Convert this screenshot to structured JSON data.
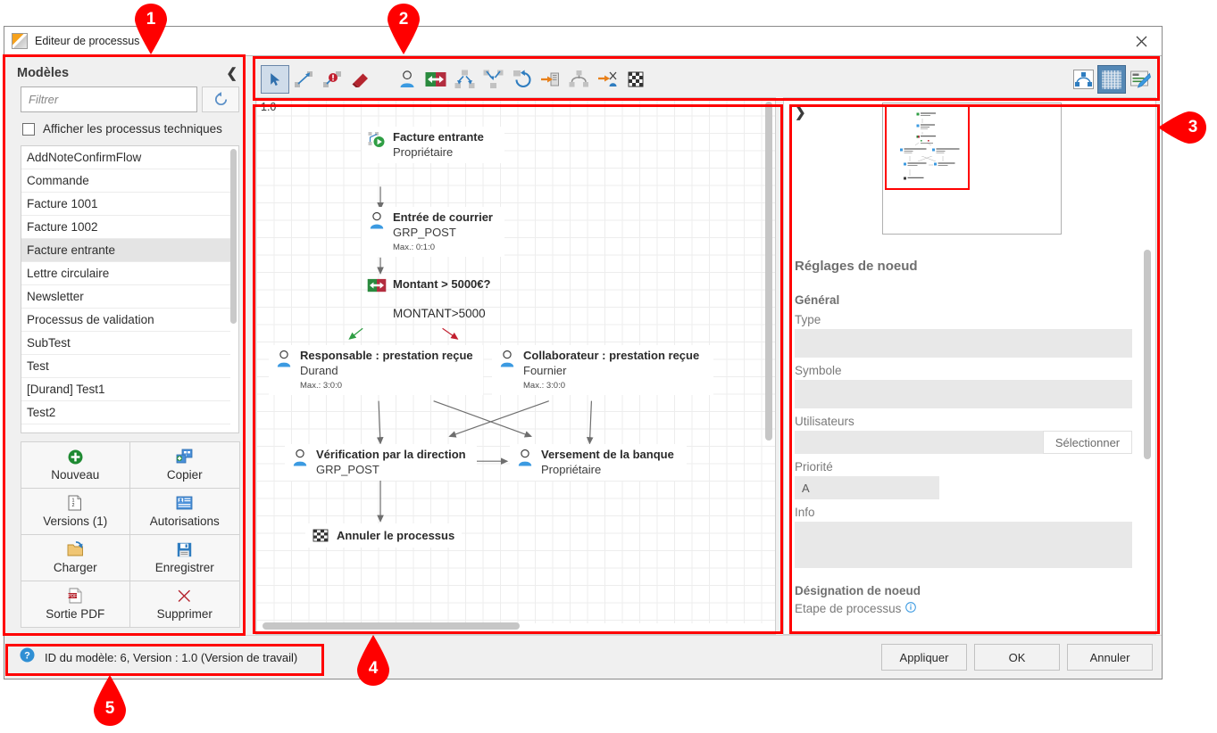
{
  "window": {
    "title": "Editeur de processus",
    "app_icon": "process-editor-icon",
    "close_icon": "close-icon"
  },
  "sidebar": {
    "title": "Modèles",
    "collapse_icon": "chevron-left-icon",
    "filter": {
      "placeholder": "Filtrer",
      "value": ""
    },
    "refresh_icon": "refresh-icon",
    "checkbox": {
      "label": "Afficher les processus techniques",
      "checked": false
    },
    "models": [
      {
        "label": "AddNoteConfirmFlow",
        "selected": false
      },
      {
        "label": "Commande",
        "selected": false
      },
      {
        "label": "Facture 1001",
        "selected": false
      },
      {
        "label": "Facture 1002",
        "selected": false
      },
      {
        "label": "Facture entrante",
        "selected": true
      },
      {
        "label": "Lettre circulaire",
        "selected": false
      },
      {
        "label": "Newsletter",
        "selected": false
      },
      {
        "label": "Processus de validation",
        "selected": false
      },
      {
        "label": "SubTest",
        "selected": false
      },
      {
        "label": "Test",
        "selected": false
      },
      {
        "label": "[Durand] Test1",
        "selected": false
      },
      {
        "label": "Test2",
        "selected": false
      }
    ],
    "buttons": [
      {
        "label": "Nouveau",
        "icon": "plus-circle-icon"
      },
      {
        "label": "Copier",
        "icon": "copy-icon"
      },
      {
        "label": "Versions (1)",
        "icon": "versions-icon"
      },
      {
        "label": "Autorisations",
        "icon": "permissions-icon"
      },
      {
        "label": "Charger",
        "icon": "load-folder-icon"
      },
      {
        "label": "Enregistrer",
        "icon": "save-floppy-icon"
      },
      {
        "label": "Sortie PDF",
        "icon": "pdf-icon"
      },
      {
        "label": "Supprimer",
        "icon": "delete-x-icon"
      }
    ]
  },
  "toolbar": {
    "left_tools": [
      {
        "name": "select-cursor-tool",
        "active": true
      },
      {
        "name": "connection-tool",
        "active": false
      },
      {
        "name": "error-connection-tool",
        "active": false
      },
      {
        "name": "eraser-tool",
        "active": false
      }
    ],
    "node_tools": [
      {
        "name": "user-task-node-tool",
        "active": false
      },
      {
        "name": "decision-node-tool",
        "active": false
      },
      {
        "name": "split-node-tool",
        "active": false
      },
      {
        "name": "join-node-tool",
        "active": false
      },
      {
        "name": "loop-node-tool",
        "active": false
      },
      {
        "name": "document-node-tool",
        "active": false
      },
      {
        "name": "subprocess-node-tool",
        "active": false
      },
      {
        "name": "script-node-tool",
        "active": false
      },
      {
        "name": "end-flag-node-tool",
        "active": false
      }
    ],
    "right_tools": [
      {
        "name": "auto-layout-tool",
        "active": false
      },
      {
        "name": "grid-toggle-tool",
        "active": true
      },
      {
        "name": "edit-properties-tool",
        "active": false
      }
    ]
  },
  "canvas": {
    "zoom": "1.0",
    "nodes": [
      {
        "id": "start",
        "icon": "process-start-icon",
        "title": "Facture entrante",
        "sub": "Propriétaire",
        "meta": "",
        "cond": ""
      },
      {
        "id": "mail",
        "icon": "user-icon",
        "title": "Entrée de courrier",
        "sub": "GRP_POST",
        "meta": "Max.: 0:1:0",
        "cond": ""
      },
      {
        "id": "decision",
        "icon": "decision-icon",
        "title": "Montant > 5000€?",
        "sub": "",
        "meta": "",
        "cond": "MONTANT>5000"
      },
      {
        "id": "resp",
        "icon": "user-icon",
        "title": "Responsable : prestation reçue",
        "sub": "Durand",
        "meta": "Max.: 3:0:0",
        "cond": ""
      },
      {
        "id": "collab",
        "icon": "user-icon",
        "title": "Collaborateur : prestation reçue",
        "sub": "Fournier",
        "meta": "Max.: 3:0:0",
        "cond": ""
      },
      {
        "id": "verif",
        "icon": "user-icon",
        "title": "Vérification par la direction",
        "sub": "GRP_POST",
        "meta": "",
        "cond": ""
      },
      {
        "id": "bank",
        "icon": "user-icon",
        "title": "Versement de la banque",
        "sub": "Propriétaire",
        "meta": "",
        "cond": ""
      },
      {
        "id": "cancel",
        "icon": "checkered-flag-icon",
        "title": "Annuler le processus",
        "sub": "",
        "meta": "",
        "cond": ""
      }
    ]
  },
  "right_panel": {
    "collapse_icon": "chevron-right-icon",
    "minimap_name": "diagram-minimap",
    "heading": "Réglages de noeud",
    "section_general": "Général",
    "fields": [
      {
        "label": "Type",
        "value": ""
      },
      {
        "label": "Symbole",
        "value": ""
      },
      {
        "label": "Utilisateurs",
        "value": ""
      },
      {
        "label": "Priorité",
        "value": "A"
      },
      {
        "label": "Info",
        "value": ""
      }
    ],
    "select_button": "Sélectionner",
    "section_node_designation": "Désignation de noeud",
    "cut_label": "Etape de processus",
    "info_icon": "info-icon"
  },
  "footer": {
    "status_icon": "help-icon",
    "status_text": "ID du modèle: 6, Version : 1.0 (Version de travail)",
    "buttons": [
      {
        "label": "Appliquer"
      },
      {
        "label": "OK"
      },
      {
        "label": "Annuler"
      }
    ]
  },
  "annotations": {
    "markers": [
      {
        "number": "1",
        "target": "sidebar-region"
      },
      {
        "number": "2",
        "target": "toolbar-region"
      },
      {
        "number": "3",
        "target": "right-panel-region"
      },
      {
        "number": "4",
        "target": "canvas-region"
      },
      {
        "number": "5",
        "target": "status-region"
      }
    ],
    "color": "#ff0000"
  }
}
